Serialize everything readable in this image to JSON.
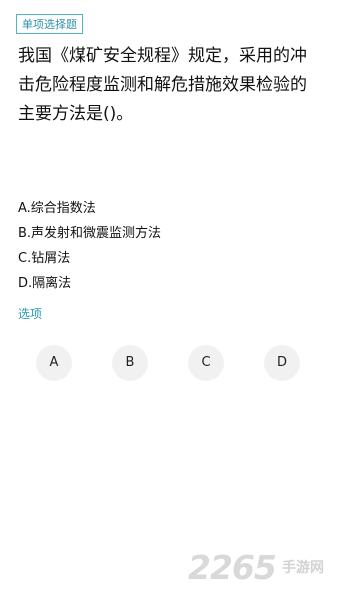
{
  "question": {
    "type_badge": "单项选择题",
    "text": "我国《煤矿安全规程》规定，采用的冲击危险程度监测和解危措施效果检验的主要方法是()。"
  },
  "options": [
    {
      "label": "A.综合指数法"
    },
    {
      "label": "B.声发射和微震监测方法"
    },
    {
      "label": "C.钻屑法"
    },
    {
      "label": "D.隔离法"
    }
  ],
  "answer_section": {
    "label": "选项",
    "choices": [
      "A",
      "B",
      "C",
      "D"
    ]
  },
  "watermark": {
    "digits": "2265",
    "suffix": "手游网"
  }
}
